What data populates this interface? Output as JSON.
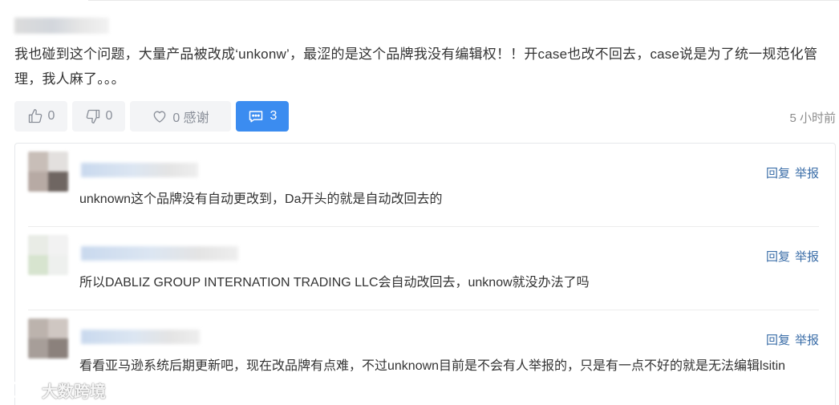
{
  "post": {
    "text": "我也碰到这个问题，大量产品被改成‘unkonw’，最涩的是这个品牌我没有编辑权！！开case也改不回去，case说是为了统一规范化管理，我人麻了。。。"
  },
  "actions": {
    "like_count": "0",
    "dislike_count": "0",
    "thanks_label": "0 感谢",
    "comment_count": "3",
    "timestamp": "5 小时前"
  },
  "replies": [
    {
      "text": "unknown这个品牌没有自动更改到，Da开头的就是自动改回去的",
      "reply_label": "回复",
      "report_label": "举报"
    },
    {
      "text": "所以DABLIZ GROUP INTERNATION TRADING LLC会自动改回去，unknow就没办法了吗",
      "reply_label": "回复",
      "report_label": "举报"
    },
    {
      "text": "看看亚马逊系统后期更新吧，现在改品牌有点难，不过unknown目前是不会有人举报的，只是有一点不好的就是无法编辑lsitin",
      "reply_label": "回复",
      "report_label": "举报"
    }
  ],
  "watermark": {
    "text": "大数跨境"
  },
  "icons": {
    "like": "thumbs-up-icon",
    "dislike": "thumbs-down-icon",
    "thanks": "heart-icon",
    "comments": "comment-bubble-icon",
    "watermark": "logo-icon"
  },
  "colors": {
    "accent": "#3b8cf0",
    "link": "#3b6ea8",
    "muted": "#8a8f99"
  }
}
